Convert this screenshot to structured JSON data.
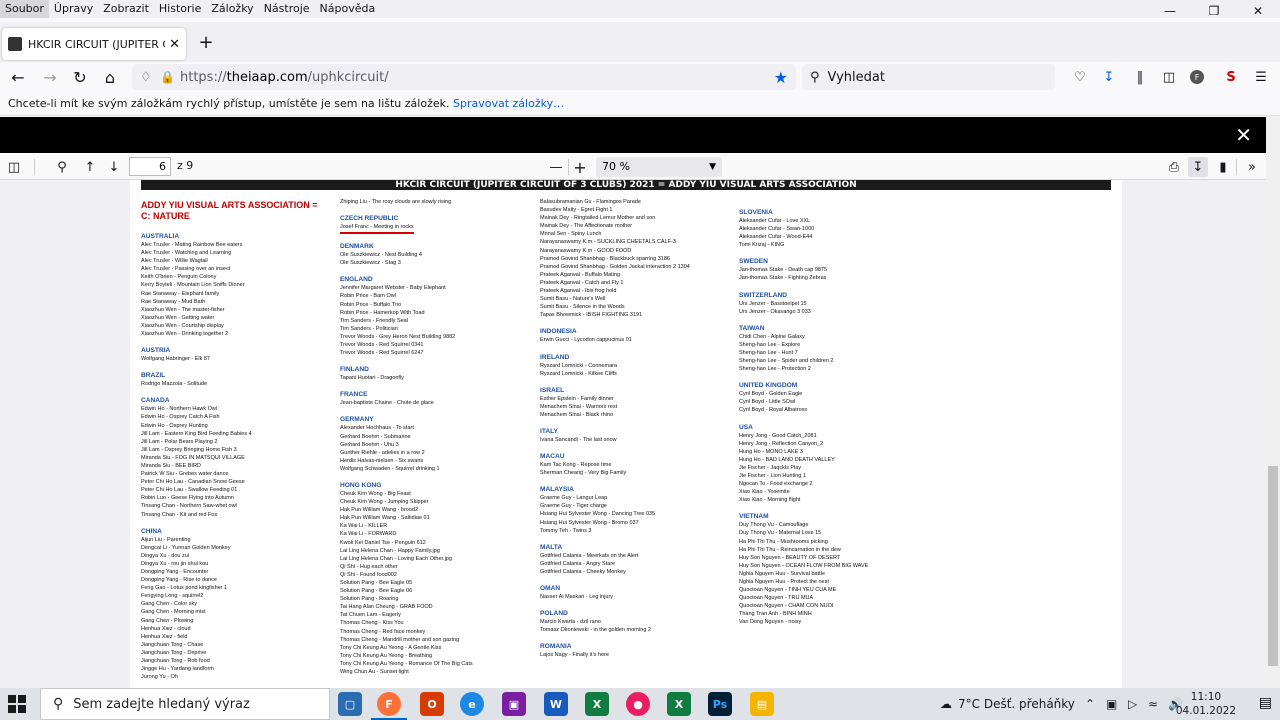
{
  "menubar": {
    "items": [
      "Soubor",
      "Úpravy",
      "Zobrazit",
      "Historie",
      "Záložky",
      "Nástroje",
      "Nápověda"
    ]
  },
  "tab": {
    "title": "HKCIR CIRCUIT (JUPITER CIRCUI"
  },
  "address": {
    "scheme": "https://",
    "host": "theiaap.com",
    "path": "/uphkcircuit/"
  },
  "search": {
    "placeholder": "Vyhledat"
  },
  "bookmarks_bar": {
    "message": "Chcete-li mít ke svým záložkám rychlý přístup, umístěte je sem na lištu záložek.",
    "link": "Spravovat záložky…"
  },
  "pdf_toolbar": {
    "page": "6",
    "of_pages": "z 9",
    "zoom": "70 %"
  },
  "pdf": {
    "header": "HKCIR CIRCUIT (JUPITER CIRCUIT OF 3 CLUBS) 2021   =   ADDY YIU VISUAL ARTS ASSOCIATION",
    "section_title_1": "ADDY YIU VISUAL ARTS ASSOCIATION  =",
    "section_title_2": "C: NATURE",
    "columns": [
      [
        {
          "country": "AUSTRALIA",
          "entries": [
            "Alec Trusler - Mating Rainbow Bee eaters",
            "Alec Trusler - Watching and Learning",
            "Alec Trusler - Willie Wagtail",
            "Alec Trusler - Passing over an insect",
            "Keith O'brien - Penguin Colony",
            "Kerry Boyteli - Mountain Lion Sniffs Dinner",
            "Rae Stanaway - Elephant family",
            "Rae Stanaway - Mud Bath",
            "Xiaozhuo Wen - The master-fisher",
            "Xiaozhuo Wen - Getting water",
            "Xiaozhuo Wen - Courtship display",
            "Xiaozhuo Wen - Drinking together 2"
          ]
        },
        {
          "country": "AUSTRIA",
          "entries": [
            "Wolfgang Habringer - Elk 87"
          ]
        },
        {
          "country": "BRAZIL",
          "entries": [
            "Rodrigo Mazzola - Solitude"
          ]
        },
        {
          "country": "CANADA",
          "entries": [
            "Edwin Ho - Northern Hawk Owl",
            "Edwin Ho - Osprey Catch A Fish",
            "Edwin Ho - Osprey Hunting",
            "Jill Lam - Eastern King Bird Feeding Babies 4",
            "Jill Lam - Polar Bears Playing 2",
            "Jill Lam - Osprey Bringing Home Fish 3",
            "Miranda Siu - FOG IN MATSQUI VILLAGE",
            "Miranda Siu - BEE BIRD",
            "Patrick W Siu - Grebes water dance",
            "Peter Chi Ho Lau - Canadian Snow Geese",
            "Peter Chi Ho Lau - Swallow Feeding 01",
            "Robin Luo - Geese Flying into Autumn",
            "Tinsang Chan - Northern Saw-whet owl",
            "Tinsang Chan - Kit and red Fox"
          ]
        },
        {
          "country": "CHINA",
          "entries": [
            "Aijun Liu - Parenting",
            "Dengcai Li - Yunnan Golden Monkey",
            "Dingya Xu - dou zui",
            "Dingya Xu - rou jin shui kou",
            "Dongping Yang - Encounter",
            "Dongping Yang - Rise to dance",
            "Feng Gao - Lotus pond kingfisher 1",
            "Fengying Long - squirrel2",
            "Gang Chen - Color sky",
            "Gang Chen - Morning mist",
            "Gang Chen - Plowing",
            "Henhua Xiez - cloud",
            "Henhua Xiez - field",
            "Jiangchuan Tong - Chase",
            "Jiangchuan Tong - Deprive",
            "Jiangchuan Tong - Rob food",
            "Jingge Hu - Yardang landform",
            "Jurong Yu - Oh"
          ]
        }
      ],
      [
        {
          "country": "",
          "entries": [
            "Zhiping Liu - The rosy clouds are slowly rising"
          ]
        },
        {
          "country": "CZECH REPUBLIC",
          "entries": [
            "Josef Franc - Meeting in rocks"
          ]
        },
        {
          "country": "DENMARK",
          "entries": [
            "Ole Suszkiewicz - Nest Building 4",
            "Ole Suszkiewicz - Stag 3"
          ]
        },
        {
          "country": "ENGLAND",
          "entries": [
            "Jennifer  Margaret Webster - Baby Elephant",
            "Robin Price - Barn Owl",
            "Robin Price - Buffalo Trio",
            "Robin Price - Hamerkop With Toad",
            "Tim Sanders - Friendly Seal",
            "Tim Sanders - Politician",
            "Trevor Woods - Grey Heron Nest Building 9882",
            "Trevor Woods - Red Squirrel 0341",
            "Trevor Woods - Red Squirrel 6247"
          ]
        },
        {
          "country": "FINLAND",
          "entries": [
            "Tapani Huotari - Dragonfly"
          ]
        },
        {
          "country": "FRANCE",
          "entries": [
            "Jean-baptiste Chaine - Chute de glace"
          ]
        },
        {
          "country": "GERMANY",
          "entries": [
            "Alexander Hochhaus - To start",
            "Gerhard Boehm - Submarine",
            "Gerhard Boehm - Uhu  3",
            "Gunther Riehle - adelies in a row 2",
            "Herdis Halvas-nielsen - Six swans",
            "Wolfgang Schwaden - Squirrel drinking 1"
          ]
        },
        {
          "country": "HONG KONG",
          "entries": [
            "Cheuk Kim Wong - Big Feast",
            "Cheuk Kim Wong - Jumping Skipper",
            "Hak Pun William Wang - brood2",
            "Hak Pun William Wang - Saltidiae 01",
            "Ka Wai Li - KILLER",
            "Ka Wai Li - FORWARD",
            "Kwok Kei Daniel Tse - Penguin 612",
            "Lai Ling Helena Chan - Happy Family.jpg",
            "Lai Ling Helena Chan - Loving Each Other.jpg",
            "Qi Shi - Hug each other",
            "Qi Shi - Found food002",
            "Solution Pang - Bee Eagle 05",
            "Solution Pang - Bee Eagle 06",
            "Solution Pang - Roaring",
            "Tai Hang Alan Cheung - GRAB FOOD",
            "Tat Chuen Lam - Eagerly",
            "Thomas Cheng - Kiss You",
            "Thomas Cheng - Red face monkey",
            "Thomas Cheng - Mandrill mother and son gazing",
            "Tony Chi Keung Au Yeong - A Gentle Kiss",
            "Tony Chi Keung Au Yeong - Breathing",
            "Tony Chi Keung Au Yeong - Romance Of The Big Cats",
            "Wing Chun Au - Sunset light"
          ]
        }
      ],
      [
        {
          "country": "",
          "entries": [
            "Balasubramanian Gv - Flamingos Parade",
            "Basudev Maity - Egret Fight 1",
            "Mainak Dey - Ringtailed Lemur Mother and son",
            "Mainak Dey - The Affectionate mother",
            "Mrinal Sen - Spiny Lunch",
            "Narayanaswamy K.m - SUCKLING CHEETALS CALF-3",
            "Narayanaswamy K.m - GOOD FOOD",
            "Pramod Govind Shanbhag - Blackbuck sparring 3186",
            "Pramod Govind Shanbhag - Golden Jackal interaction 2 1304",
            "Prateek Agarwal - Buffalo Mating",
            "Prateek Agarwal - Catch and Fly 1",
            "Prateek Agarwal - Ibis frog hold",
            "Sumit Basu - Nature's Well",
            "Sumit Basu - Silence in the Woods",
            "Tapas Bhowmick - IBISH FIGHTING 3191"
          ]
        },
        {
          "country": "INDONESIA",
          "entries": [
            "Erwin Gucci - Lycodon cappucinus 01"
          ]
        },
        {
          "country": "IRELAND",
          "entries": [
            "Ryszard Lomnicki - Connemara",
            "Ryszard Lomnicki - Kilkee Cliffs"
          ]
        },
        {
          "country": "ISRAEL",
          "entries": [
            "Esther Epstein - Family dinner",
            "Menachem Sinai - Warriors rest",
            "Menachem Sinai - Black rhino"
          ]
        },
        {
          "country": "ITALY",
          "entries": [
            "Ivana Sancandi - The last snow"
          ]
        },
        {
          "country": "MACAU",
          "entries": [
            "Kam Tac Kong - Repose time",
            "Sherman Cheang - Very Big Family"
          ]
        },
        {
          "country": "MALAYSIA",
          "entries": [
            "Graeme Guy - Langur Leap",
            "Graeme Guy - Tiger charge",
            "Hsiang Hui Sylvester Wong - Dancing Tree 035",
            "Hsiang Hui Sylvester Wong - Bromo 037",
            "Tommy Teh - Twins 3"
          ]
        },
        {
          "country": "MALTA",
          "entries": [
            "Gottfried Catania - Meerkats on the Alert",
            "Gottfried Catania - Angry Stare",
            "Gottfried Catania - Cheeky Monkey"
          ]
        },
        {
          "country": "OMAN",
          "entries": [
            "Nasser Al Maskari - Leg injury"
          ]
        },
        {
          "country": "POLAND",
          "entries": [
            "Marcin Kwarta - dzil rano",
            "Tomasz Okoniewski - in the golden morning 2"
          ]
        },
        {
          "country": "ROMANIA",
          "entries": [
            "Lajos Nagy - Finally it's here"
          ]
        }
      ],
      [
        {
          "country": "SLOVENIA",
          "entries": [
            "Aleksander Cufar - Love XXL",
            "Aleksander Cufar - Swan-1000",
            "Aleksander Cufar - Wood-E44",
            "Tomi Krizaj - KING"
          ]
        },
        {
          "country": "SWEDEN",
          "entries": [
            "Jan-thomas Stake - Death cap 9875",
            "Jan-thomas Stake - Fighting Zebras"
          ]
        },
        {
          "country": "SWITZERLAND",
          "entries": [
            "Urs Jenzer - Basstoelpel 15",
            "Urs Jenzer - Okavango 3 033"
          ]
        },
        {
          "country": "TAIWAN",
          "entries": [
            "Chidi Chen - Alpine Galaxy",
            "Sheng-hao Lee - Explore",
            "Sheng-hao Lee - Hunt 7",
            "Sheng-hao Lee - Spider and children 2",
            "Sheng-hao Lee - Protection 2"
          ]
        },
        {
          "country": "UNITED KINGDOM",
          "entries": [
            "Cyril Boyd - Golden Eagle",
            "Cyril Boyd - Little SOwl",
            "Cyril Boyd - Royal Albatross"
          ]
        },
        {
          "country": "USA",
          "entries": [
            "Henry Jong - Good Catch_2081",
            "Henry Jong - Reflection Canyon_2",
            "Hung Ho - MONO LAKE 3",
            "Hung Ho - BAD LAND DEATH VALLEY",
            "Jie Fischer - Jaqckls Play",
            "Jie Fischer - Lion Hunting 1",
            "Ngocan To - Food exchange 2",
            "Xiao Xiao - Yosemite",
            "Xiao Xiao - Morning flight"
          ]
        },
        {
          "country": "VIETNAM",
          "entries": [
            "Duy Thong Vu - Camouflage",
            "Duy Thong Vu - Maternal Love 15",
            "Ha Phi Thi Thu - Mushrooms picking",
            "Ha Phi Thi Thu - Reincarnation in the dew",
            "Huy Son  Nguyen - BEAUTY OF DESERT",
            "Huy Son  Nguyen - OCEAN FLOW FROM BIG WAVE",
            "Nghia Nguyen Huu - Survival battle",
            "Nghia Nguyen Huu - Protect the nest",
            "Quoctoan Nguyen - TINH YEU CUA ME",
            "Quoctoan Nguyen - TRU MUA",
            "Quoctoan Nguyen - CHAM CON NUOI",
            "Thang Tran Anh -                BINH MINH",
            "Van Dong Nguyen - noisy"
          ]
        }
      ]
    ]
  },
  "taskbar": {
    "search_placeholder": "Sem zadejte hledaný výraz",
    "weather": "7°C  Dešť. přeháňky",
    "time": "11:10",
    "date": "04.01.2022"
  }
}
